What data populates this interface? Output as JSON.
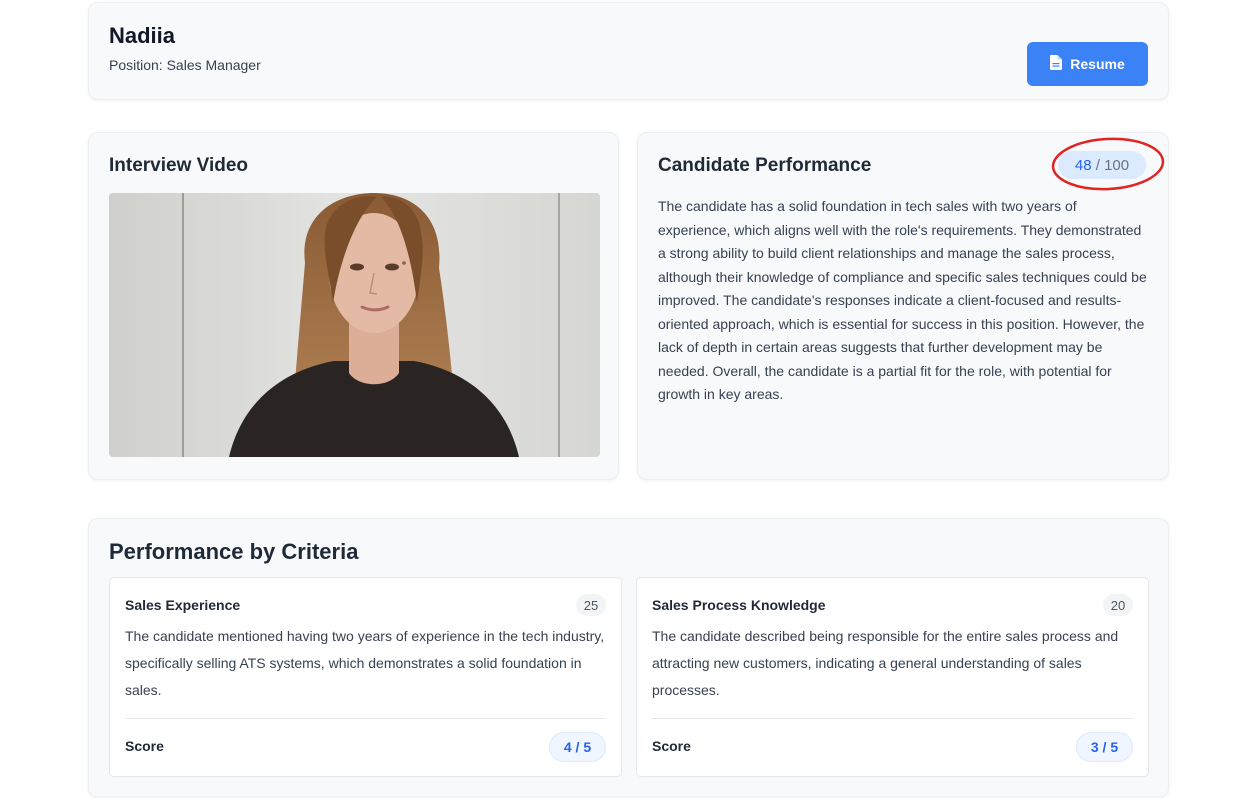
{
  "candidate": {
    "name": "Nadiia",
    "position": "Position: Sales Manager",
    "resume_label": "Resume"
  },
  "video": {
    "title": "Interview Video"
  },
  "performance": {
    "title": "Candidate Performance",
    "score": "48",
    "separator": " / ",
    "max": "100",
    "summary": "The candidate has a solid foundation in tech sales with two years of experience, which aligns well with the role's requirements. They demonstrated a strong ability to build client relationships and manage the sales process, although their knowledge of compliance and specific sales techniques could be improved. The candidate's responses indicate a client-focused and results-oriented approach, which is essential for success in this position. However, the lack of depth in certain areas suggests that further development may be needed. Overall, the candidate is a partial fit for the role, with potential for growth in key areas."
  },
  "criteria": {
    "title": "Performance by Criteria",
    "items": [
      {
        "name": "Sales Experience",
        "weight": "25",
        "description": "The candidate mentioned having two years of experience in the tech industry, specifically selling ATS systems, which demonstrates a solid foundation in sales.",
        "score_label": "Score",
        "score": "4 / 5"
      },
      {
        "name": "Sales Process Knowledge",
        "weight": "20",
        "description": "The candidate described being responsible for the entire sales process and attracting new customers, indicating a general understanding of sales processes.",
        "score_label": "Score",
        "score": "3 / 5"
      }
    ]
  },
  "colors": {
    "primary": "#3b82f6",
    "score_text": "#2563eb",
    "highlight_annotation": "#e02424",
    "card_bg": "#f8f9fb"
  },
  "icons": {
    "resume": "document-icon"
  }
}
